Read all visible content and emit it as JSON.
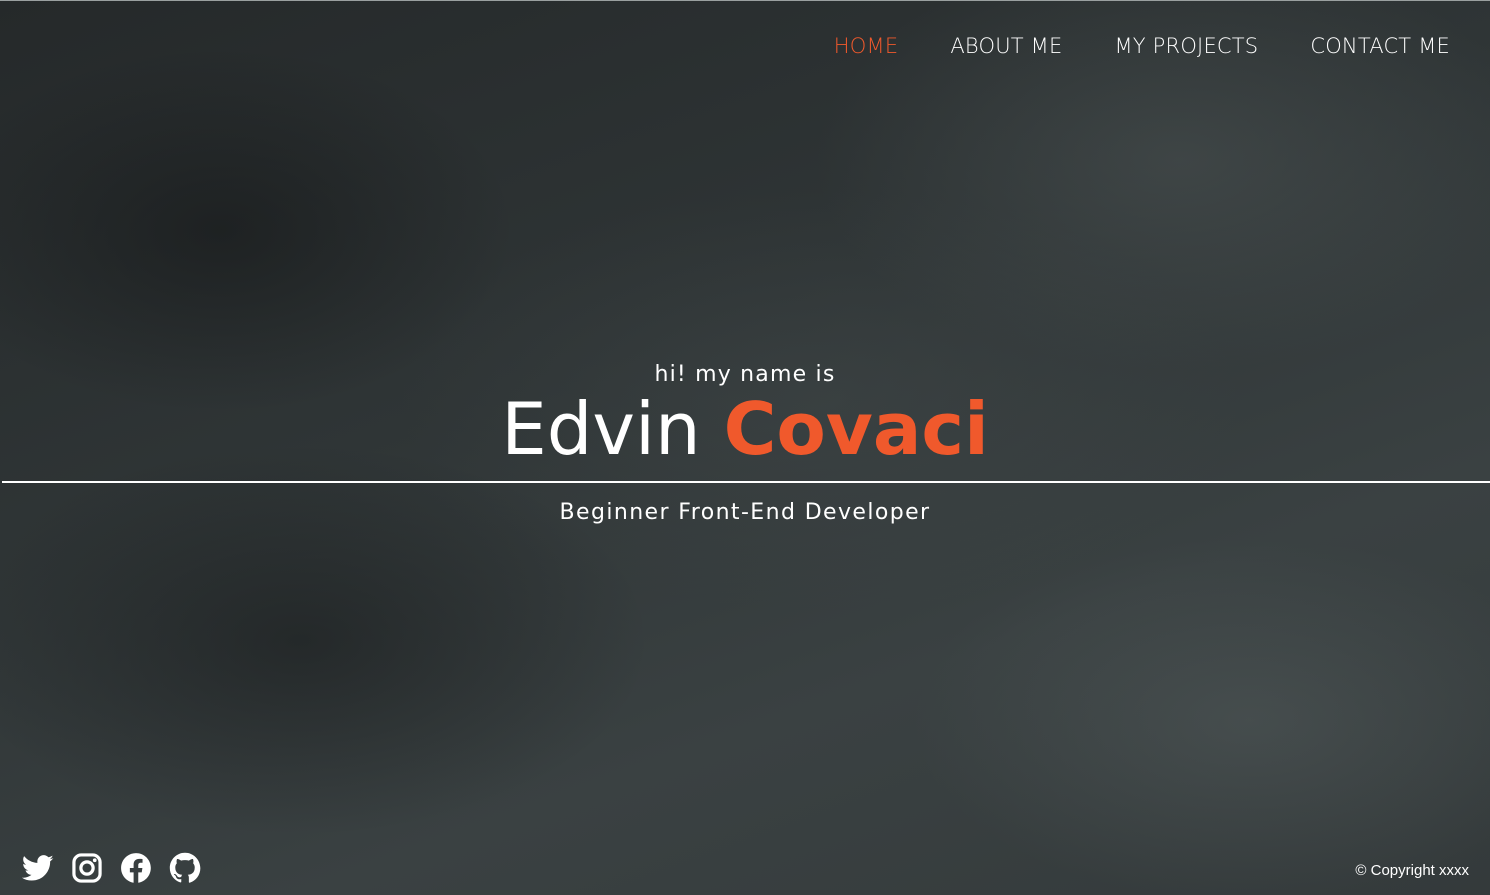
{
  "nav": {
    "items": [
      {
        "label": "HOME",
        "active": true
      },
      {
        "label": "ABOUT ME",
        "active": false
      },
      {
        "label": "MY PROJECTS",
        "active": false
      },
      {
        "label": "CONTACT ME",
        "active": false
      }
    ]
  },
  "hero": {
    "greeting": "hi! my name is",
    "first_name": "Edvin",
    "last_name": "Covaci",
    "subtitle": "Beginner Front-End Developer"
  },
  "social": {
    "icons": [
      "twitter-icon",
      "instagram-icon",
      "facebook-icon",
      "github-icon"
    ]
  },
  "footer": {
    "copyright": "© Copyright xxxx"
  },
  "colors": {
    "accent": "#f0592c",
    "text": "#ffffff",
    "background": "#2f3435"
  }
}
